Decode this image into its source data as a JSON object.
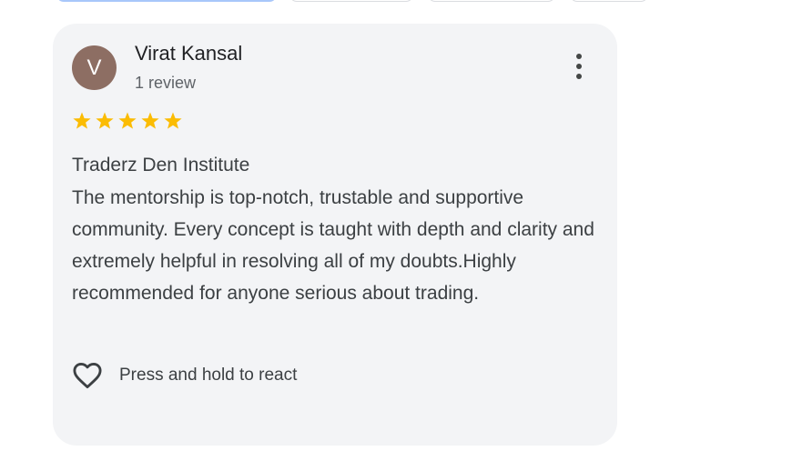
{
  "filter_chips": [
    "",
    "",
    "",
    ""
  ],
  "review": {
    "avatar_initial": "V",
    "reviewer_name": "Virat Kansal",
    "review_count": "1 review",
    "rating": 5,
    "rating_max": 5,
    "place_name": "Traderz Den Institute",
    "text": "The mentorship is top-notch, trustable and supportive community. Every concept is taught with depth and clarity and extremely helpful in resolving all of my doubts.Highly recommended for anyone serious about trading.",
    "react_label": "Press and hold to react",
    "more_icon": "more-vert-icon",
    "react_icon": "heart-outline-icon"
  },
  "colors": {
    "card_background": "#f3f4f6",
    "avatar_background": "#8d6e63",
    "star": "#fbbc04",
    "text": "#3c4043",
    "secondary_text": "#5f6368"
  }
}
